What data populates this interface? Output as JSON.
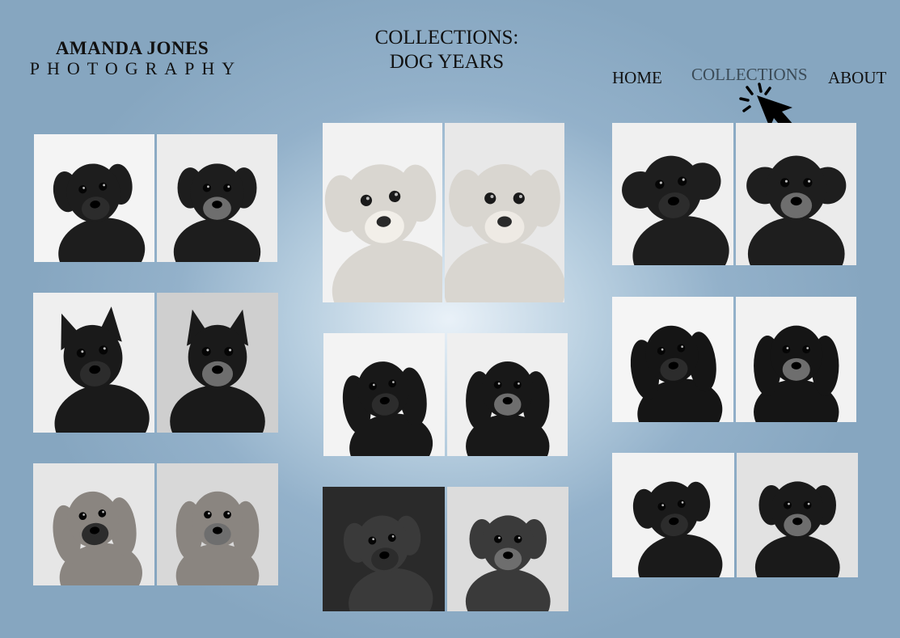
{
  "brand": {
    "line1": "AMANDA JONES",
    "line2": "PHOTOGRAPHY"
  },
  "page_title": {
    "line1": "COLLECTIONS:",
    "line2": "DOG YEARS"
  },
  "nav": {
    "home": "HOME",
    "collections": "COLLECTIONS",
    "about": "ABOUT",
    "active": "collections"
  },
  "gallery": [
    {
      "breed": "pug",
      "dog_color": "#1d1d1d",
      "bg_left": "#f4f4f4",
      "bg_right": "#ececec",
      "ears": "fold"
    },
    {
      "breed": "wire-haired-dachshund",
      "dog_color": "#d9d6d0",
      "bg_left": "#f2f2f2",
      "bg_right": "#e8e8e8",
      "ears": "floppy"
    },
    {
      "breed": "poodle",
      "dog_color": "#1e1e1e",
      "bg_left": "#f0f0f0",
      "bg_right": "#ebebeb",
      "ears": "curly"
    },
    {
      "breed": "shiba-inu",
      "dog_color": "#1a1a1a",
      "bg_left": "#efefef",
      "bg_right": "#cfcfcf",
      "ears": "pointed"
    },
    {
      "breed": "long-haired-dachshund-1",
      "dog_color": "#181818",
      "bg_left": "#f3f3f3",
      "bg_right": "#efefef",
      "ears": "long"
    },
    {
      "breed": "long-haired-dachshund-2",
      "dog_color": "#151515",
      "bg_left": "#f5f5f5",
      "bg_right": "#f2f2f2",
      "ears": "long"
    },
    {
      "breed": "basset-hound",
      "dog_color": "#8a8580",
      "bg_left": "#e6e6e6",
      "bg_right": "#d8d8d8",
      "ears": "long"
    },
    {
      "breed": "hound-mix",
      "dog_color": "#3a3a3a",
      "bg_left": "#2a2a2a",
      "bg_right": "#dcdcdc",
      "ears": "floppy"
    },
    {
      "breed": "labrador",
      "dog_color": "#1a1a1a",
      "bg_left": "#f2f2f2",
      "bg_right": "#e2e2e2",
      "ears": "floppy"
    }
  ]
}
